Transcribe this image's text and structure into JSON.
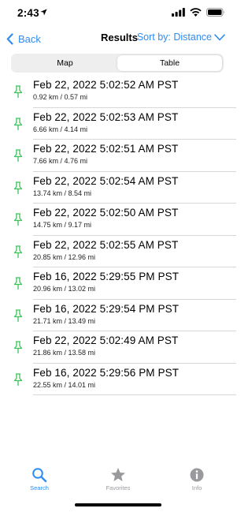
{
  "status_bar": {
    "time": "2:43"
  },
  "nav": {
    "back_label": "Back",
    "title": "Results",
    "sort_label": "Sort by: Distance"
  },
  "segmented": {
    "options": [
      "Map",
      "Table"
    ],
    "selected": "Table"
  },
  "results": [
    {
      "date": "Feb 22, 2022 5:02:52 AM PST",
      "distance": "0.92 km / 0.57 mi"
    },
    {
      "date": "Feb 22, 2022 5:02:53 AM PST",
      "distance": "6.66 km / 4.14 mi"
    },
    {
      "date": "Feb 22, 2022 5:02:51 AM PST",
      "distance": "7.66 km / 4.76 mi"
    },
    {
      "date": "Feb 22, 2022 5:02:54 AM PST",
      "distance": "13.74 km / 8.54 mi"
    },
    {
      "date": "Feb 22, 2022 5:02:50 AM PST",
      "distance": "14.75 km / 9.17 mi"
    },
    {
      "date": "Feb 22, 2022 5:02:55 AM PST",
      "distance": "20.85 km / 12.96 mi"
    },
    {
      "date": "Feb 16, 2022 5:29:55 PM PST",
      "distance": "20.96 km / 13.02 mi"
    },
    {
      "date": "Feb 16, 2022 5:29:54 PM PST",
      "distance": "21.71 km / 13.49 mi"
    },
    {
      "date": "Feb 22, 2022 5:02:49 AM PST",
      "distance": "21.86 km / 13.58 mi"
    },
    {
      "date": "Feb 16, 2022 5:29:56 PM PST",
      "distance": "22.55 km / 14.01 mi"
    }
  ],
  "tabs": [
    {
      "label": "Search",
      "icon": "magnifier-icon",
      "active": true
    },
    {
      "label": "Favorites",
      "icon": "star-icon",
      "active": false
    },
    {
      "label": "Info",
      "icon": "info-icon",
      "active": false
    }
  ],
  "colors": {
    "accent": "#2f8cf2",
    "pin": "#3cc35a",
    "inactive_tab": "#9a9a9e"
  }
}
